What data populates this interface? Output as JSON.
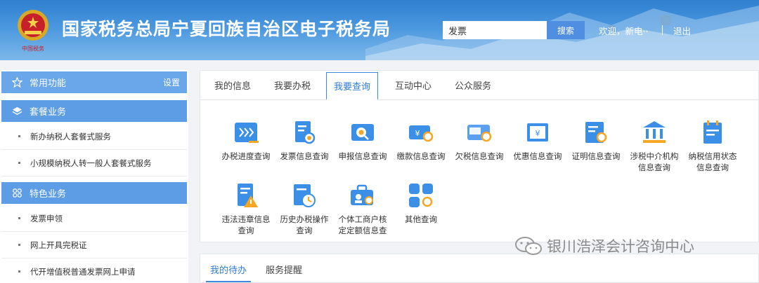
{
  "header": {
    "title": "国家税务总局宁夏回族自治区电子税务局",
    "search_value": "发票",
    "search_button": "搜索",
    "welcome": "欢迎，新电··",
    "logout": "退出",
    "emblem_caption": "中国税务"
  },
  "sidebar": {
    "common": {
      "label": "常用功能",
      "settings": "设置"
    },
    "package": {
      "label": "套餐业务",
      "items": [
        "新办纳税人套餐式服务",
        "小规模纳税人转一般人套餐式服务"
      ]
    },
    "feature": {
      "label": "特色业务",
      "items": [
        "发票申领",
        "网上开具完税证",
        "代开增值税普通发票网上申请"
      ]
    }
  },
  "tabs": [
    "我的信息",
    "我要办税",
    "我要查询",
    "互动中心",
    "公众服务"
  ],
  "active_tab": "我要查询",
  "queries": [
    {
      "label": "办税进度查询",
      "icon": "progress-query-icon"
    },
    {
      "label": "发票信息查询",
      "icon": "invoice-query-icon"
    },
    {
      "label": "申报信息查询",
      "icon": "declaration-query-icon"
    },
    {
      "label": "缴款信息查询",
      "icon": "payment-query-icon"
    },
    {
      "label": "欠税信息查询",
      "icon": "arrears-query-icon"
    },
    {
      "label": "优惠信息查询",
      "icon": "preferential-query-icon"
    },
    {
      "label": "证明信息查询",
      "icon": "certificate-query-icon"
    },
    {
      "label": "涉税中介机构\n信息查询",
      "icon": "intermediary-query-icon"
    },
    {
      "label": "纳税信用状态\n信息查询",
      "icon": "credit-status-query-icon"
    },
    {
      "label": "违法违章信息\n查询",
      "icon": "violation-query-icon"
    },
    {
      "label": "历史办税操作\n查询",
      "icon": "history-query-icon"
    },
    {
      "label": "个体工商户核\n定定额信息查",
      "icon": "individual-business-query-icon"
    },
    {
      "label": "其他查询",
      "icon": "other-query-icon"
    }
  ],
  "bottom_tabs": [
    "我的待办",
    "服务提醒"
  ],
  "watermark": "银川浩泽会计咨询中心",
  "colors": {
    "header": "#3d8bd8",
    "accent": "#2f7bd6",
    "sidebar_head": "#5d9de6",
    "icon_blue": "#3b8fe6",
    "icon_orange": "#f5a623"
  }
}
